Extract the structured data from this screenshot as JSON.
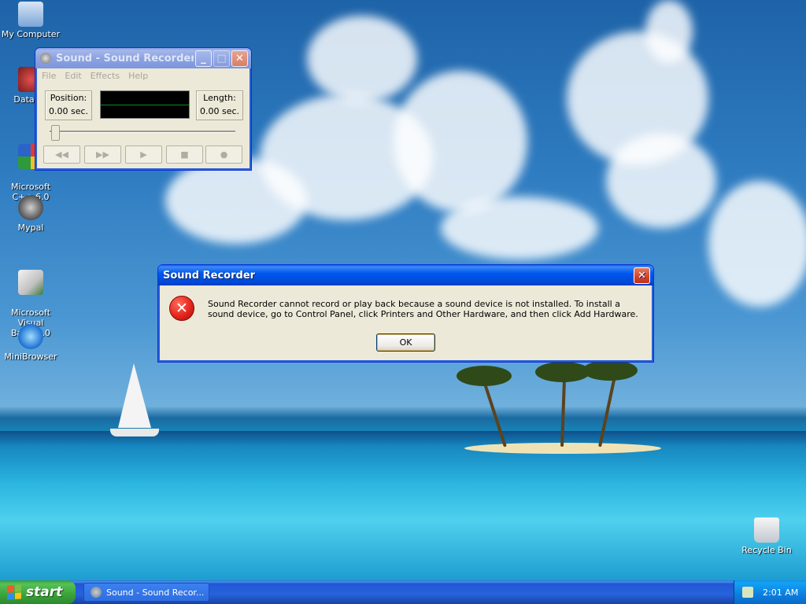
{
  "desktop": {
    "icons": [
      {
        "label": "My Computer",
        "icon": "my-computer-icon"
      },
      {
        "label": "DataWa",
        "icon": "datawarrior-icon"
      },
      {
        "label": "Microsoft\nC++ 6.0",
        "icon": "visual-cpp-icon"
      },
      {
        "label": "Mypal",
        "icon": "mypal-icon"
      },
      {
        "label": "Microsoft Visual\nBasic 6.0",
        "icon": "visual-basic-icon"
      },
      {
        "label": "MiniBrowser",
        "icon": "minibrowser-icon"
      },
      {
        "label": "Recycle Bin",
        "icon": "recycle-bin-icon"
      }
    ]
  },
  "sound_recorder": {
    "title": "Sound - Sound Recorder",
    "menu": [
      "File",
      "Edit",
      "Effects",
      "Help"
    ],
    "position_label": "Position:",
    "position_value": "0.00 sec.",
    "length_label": "Length:",
    "length_value": "0.00 sec.",
    "buttons": {
      "rewind": "◀◀",
      "fast_forward": "▶▶",
      "play": "▶",
      "stop": "■",
      "record": "●"
    }
  },
  "error_dialog": {
    "title": "Sound Recorder",
    "message": "Sound Recorder cannot record or play back because a sound device is not installed. To install a sound device, go to Control Panel, click Printers and Other Hardware, and then click Add Hardware.",
    "ok_label": "OK"
  },
  "taskbar": {
    "start_label": "start",
    "task_item_label": "Sound - Sound Recor...",
    "clock": "2:01 AM"
  },
  "colors": {
    "titlebar_active": "#0058ee",
    "taskbar": "#2663da",
    "start_green": "#3aa43a",
    "error_red": "#e5261d"
  }
}
